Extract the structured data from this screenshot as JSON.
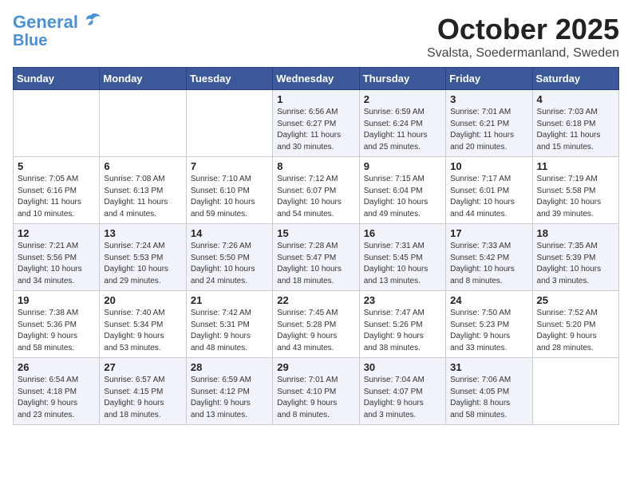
{
  "header": {
    "logo_line1": "General",
    "logo_line2": "Blue",
    "month": "October 2025",
    "location": "Svalsta, Soedermanland, Sweden"
  },
  "weekdays": [
    "Sunday",
    "Monday",
    "Tuesday",
    "Wednesday",
    "Thursday",
    "Friday",
    "Saturday"
  ],
  "weeks": [
    [
      {
        "day": "",
        "info": ""
      },
      {
        "day": "",
        "info": ""
      },
      {
        "day": "",
        "info": ""
      },
      {
        "day": "1",
        "info": "Sunrise: 6:56 AM\nSunset: 6:27 PM\nDaylight: 11 hours\nand 30 minutes."
      },
      {
        "day": "2",
        "info": "Sunrise: 6:59 AM\nSunset: 6:24 PM\nDaylight: 11 hours\nand 25 minutes."
      },
      {
        "day": "3",
        "info": "Sunrise: 7:01 AM\nSunset: 6:21 PM\nDaylight: 11 hours\nand 20 minutes."
      },
      {
        "day": "4",
        "info": "Sunrise: 7:03 AM\nSunset: 6:18 PM\nDaylight: 11 hours\nand 15 minutes."
      }
    ],
    [
      {
        "day": "5",
        "info": "Sunrise: 7:05 AM\nSunset: 6:16 PM\nDaylight: 11 hours\nand 10 minutes."
      },
      {
        "day": "6",
        "info": "Sunrise: 7:08 AM\nSunset: 6:13 PM\nDaylight: 11 hours\nand 4 minutes."
      },
      {
        "day": "7",
        "info": "Sunrise: 7:10 AM\nSunset: 6:10 PM\nDaylight: 10 hours\nand 59 minutes."
      },
      {
        "day": "8",
        "info": "Sunrise: 7:12 AM\nSunset: 6:07 PM\nDaylight: 10 hours\nand 54 minutes."
      },
      {
        "day": "9",
        "info": "Sunrise: 7:15 AM\nSunset: 6:04 PM\nDaylight: 10 hours\nand 49 minutes."
      },
      {
        "day": "10",
        "info": "Sunrise: 7:17 AM\nSunset: 6:01 PM\nDaylight: 10 hours\nand 44 minutes."
      },
      {
        "day": "11",
        "info": "Sunrise: 7:19 AM\nSunset: 5:58 PM\nDaylight: 10 hours\nand 39 minutes."
      }
    ],
    [
      {
        "day": "12",
        "info": "Sunrise: 7:21 AM\nSunset: 5:56 PM\nDaylight: 10 hours\nand 34 minutes."
      },
      {
        "day": "13",
        "info": "Sunrise: 7:24 AM\nSunset: 5:53 PM\nDaylight: 10 hours\nand 29 minutes."
      },
      {
        "day": "14",
        "info": "Sunrise: 7:26 AM\nSunset: 5:50 PM\nDaylight: 10 hours\nand 24 minutes."
      },
      {
        "day": "15",
        "info": "Sunrise: 7:28 AM\nSunset: 5:47 PM\nDaylight: 10 hours\nand 18 minutes."
      },
      {
        "day": "16",
        "info": "Sunrise: 7:31 AM\nSunset: 5:45 PM\nDaylight: 10 hours\nand 13 minutes."
      },
      {
        "day": "17",
        "info": "Sunrise: 7:33 AM\nSunset: 5:42 PM\nDaylight: 10 hours\nand 8 minutes."
      },
      {
        "day": "18",
        "info": "Sunrise: 7:35 AM\nSunset: 5:39 PM\nDaylight: 10 hours\nand 3 minutes."
      }
    ],
    [
      {
        "day": "19",
        "info": "Sunrise: 7:38 AM\nSunset: 5:36 PM\nDaylight: 9 hours\nand 58 minutes."
      },
      {
        "day": "20",
        "info": "Sunrise: 7:40 AM\nSunset: 5:34 PM\nDaylight: 9 hours\nand 53 minutes."
      },
      {
        "day": "21",
        "info": "Sunrise: 7:42 AM\nSunset: 5:31 PM\nDaylight: 9 hours\nand 48 minutes."
      },
      {
        "day": "22",
        "info": "Sunrise: 7:45 AM\nSunset: 5:28 PM\nDaylight: 9 hours\nand 43 minutes."
      },
      {
        "day": "23",
        "info": "Sunrise: 7:47 AM\nSunset: 5:26 PM\nDaylight: 9 hours\nand 38 minutes."
      },
      {
        "day": "24",
        "info": "Sunrise: 7:50 AM\nSunset: 5:23 PM\nDaylight: 9 hours\nand 33 minutes."
      },
      {
        "day": "25",
        "info": "Sunrise: 7:52 AM\nSunset: 5:20 PM\nDaylight: 9 hours\nand 28 minutes."
      }
    ],
    [
      {
        "day": "26",
        "info": "Sunrise: 6:54 AM\nSunset: 4:18 PM\nDaylight: 9 hours\nand 23 minutes."
      },
      {
        "day": "27",
        "info": "Sunrise: 6:57 AM\nSunset: 4:15 PM\nDaylight: 9 hours\nand 18 minutes."
      },
      {
        "day": "28",
        "info": "Sunrise: 6:59 AM\nSunset: 4:12 PM\nDaylight: 9 hours\nand 13 minutes."
      },
      {
        "day": "29",
        "info": "Sunrise: 7:01 AM\nSunset: 4:10 PM\nDaylight: 9 hours\nand 8 minutes."
      },
      {
        "day": "30",
        "info": "Sunrise: 7:04 AM\nSunset: 4:07 PM\nDaylight: 9 hours\nand 3 minutes."
      },
      {
        "day": "31",
        "info": "Sunrise: 7:06 AM\nSunset: 4:05 PM\nDaylight: 8 hours\nand 58 minutes."
      },
      {
        "day": "",
        "info": ""
      }
    ]
  ]
}
